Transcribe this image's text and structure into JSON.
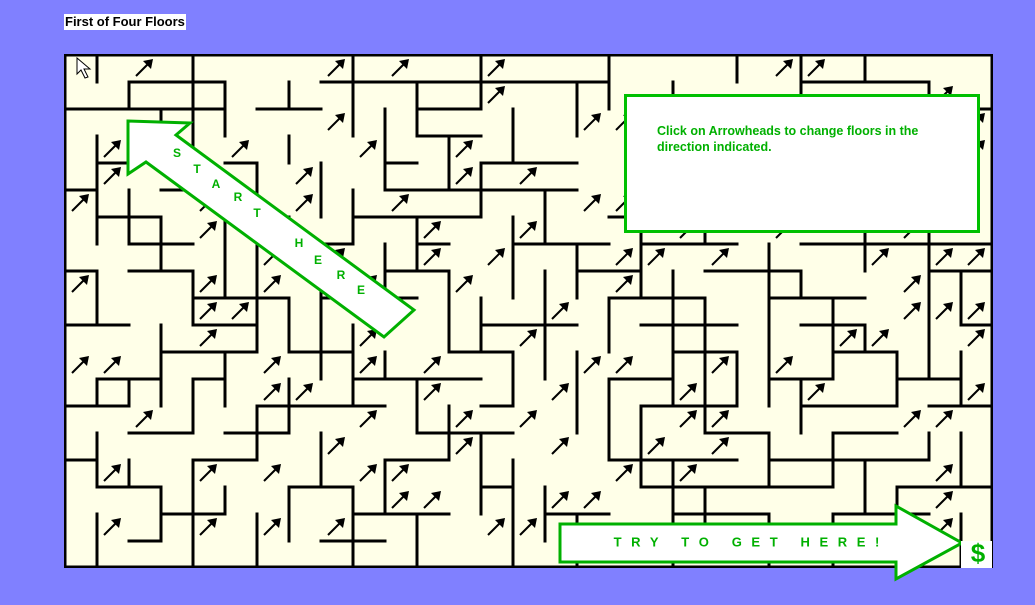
{
  "title": "First of Four Floors",
  "floor": {
    "current": 1,
    "total": 4
  },
  "instructions": "Click on Arrowheads to change floors in the direction indicated.",
  "start_label": "S T A R T   H E R E",
  "start_letters": [
    "S",
    "T",
    "A",
    "R",
    "T",
    "H",
    "E",
    "R",
    "E"
  ],
  "goal_label": "T R Y   T O   G E T   H E R E !",
  "goal_symbol": "$",
  "icons": {
    "floor_change": "up-right-arrow-icon",
    "cursor": "mouse-pointer-icon"
  },
  "colors": {
    "background": "#8080FF",
    "maze_floor": "#FFFFE8",
    "walls": "#000000",
    "accent": "#00B000",
    "panel": "#FFFFFF"
  }
}
